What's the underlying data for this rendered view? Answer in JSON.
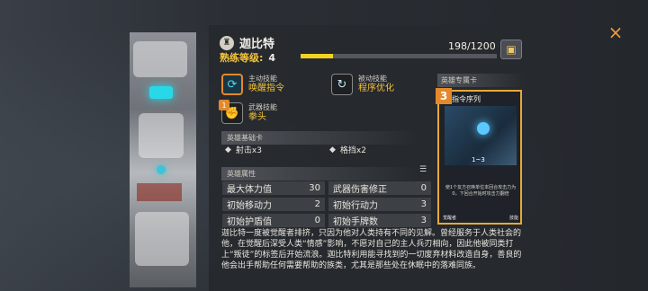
{
  "hero": {
    "name": "迦比特",
    "proficiency_label": "熟练等级:",
    "proficiency_level": "4",
    "proficiency_count": "198/1200",
    "proficiency_fraction": 0.165
  },
  "skills": {
    "active": {
      "type": "主动技能",
      "name": "唤醒指令"
    },
    "passive": {
      "type": "被动技能",
      "name": "程序优化"
    },
    "weapon": {
      "type": "武器技能",
      "name": "拳头",
      "badge": "1"
    }
  },
  "basic_cards": {
    "title": "英雄基础卡",
    "items": [
      {
        "label": "射击x3"
      },
      {
        "label": "格挡x2"
      }
    ]
  },
  "attributes": {
    "title": "英雄属性",
    "rows": [
      [
        {
          "label": "最大体力值",
          "value": "30"
        },
        {
          "label": "武器伤害修正",
          "value": "0"
        }
      ],
      [
        {
          "label": "初始移动力",
          "value": "2"
        },
        {
          "label": "初始行动力",
          "value": "3"
        }
      ],
      [
        {
          "label": "初始护盾值",
          "value": "0"
        },
        {
          "label": "初始手牌数",
          "value": "3"
        }
      ]
    ]
  },
  "description": "迦比特一度被觉醒者排挤，只因为他对人类持有不同的见解。曾经服务于人类社会的他，在觉醒后深受人类“情感”影响，不愿对自己的主人兵刃相向，因此他被同类打上“叛徒”的标签后开始流浪。迦比特利用能寻找到的一切废弃材料改造自身，善良的他会出手帮助任何需要帮助的族类，尤其是那些处在休眠中的落难同族。",
  "exclusive_card": {
    "section_title": "英雄专属卡",
    "cost": "3",
    "name": "指令序列",
    "range": "1~3",
    "text": "使1个友方召唤单位本回合攻击力为0，下回合开始时攻击力翻倍",
    "owner": "觉醒者",
    "kind": "技能"
  },
  "ui": {
    "close_icon": "×",
    "accent": "#f3c23a",
    "bar_color": "#f2d323",
    "border_orange": "#e4892b"
  }
}
